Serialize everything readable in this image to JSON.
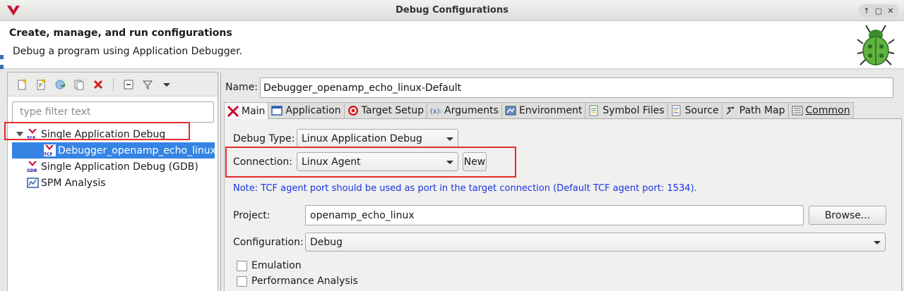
{
  "window": {
    "title": "Debug Configurations",
    "controls": [
      "up-icon",
      "restore-icon",
      "close-icon"
    ]
  },
  "header": {
    "title": "Create, manage, and run configurations",
    "description": "Debug a program using Application Debugger."
  },
  "left_panel": {
    "filter_placeholder": "type filter text",
    "tree": [
      {
        "label": "Single Application Debug",
        "icon": "tcf-icon",
        "expanded": true,
        "highlighted": true
      },
      {
        "label": "Debugger_openamp_echo_linux-Default",
        "icon": "tcf-icon",
        "selected": true
      },
      {
        "label": "Single Application Debug (GDB)",
        "icon": "gdb-icon"
      },
      {
        "label": "SPM Analysis",
        "icon": "spm-icon"
      }
    ]
  },
  "main": {
    "name_label": "Name:",
    "name_value": "Debugger_openamp_echo_linux-Default",
    "tabs": [
      {
        "label": "Main",
        "icon": "xilinx-icon",
        "active": true
      },
      {
        "label": "Application",
        "icon": "application-icon"
      },
      {
        "label": "Target Setup",
        "icon": "target-icon"
      },
      {
        "label": "Arguments",
        "icon": "arguments-icon"
      },
      {
        "label": "Environment",
        "icon": "environment-icon"
      },
      {
        "label": "Symbol Files",
        "icon": "symbol-files-icon"
      },
      {
        "label": "Source",
        "icon": "source-icon"
      },
      {
        "label": "Path Map",
        "icon": "path-map-icon"
      },
      {
        "label": "Common",
        "icon": "common-icon"
      }
    ],
    "debug_type_label": "Debug Type:",
    "debug_type_value": "Linux Application Debug",
    "connection_label": "Connection:",
    "connection_value": "Linux Agent",
    "new_button": "New",
    "note": "Note: TCF agent port should be used as port in the target connection (Default TCF agent port: 1534).",
    "project_label": "Project:",
    "project_value": "openamp_echo_linux",
    "browse_button": "Browse...",
    "configuration_label": "Configuration:",
    "configuration_value": "Debug",
    "emulation_label": "Emulation",
    "performance_label": "Performance Analysis"
  },
  "colors": {
    "highlight_box": "#e52b2b",
    "selection": "#3584e4",
    "note_text": "#1a33e6"
  }
}
